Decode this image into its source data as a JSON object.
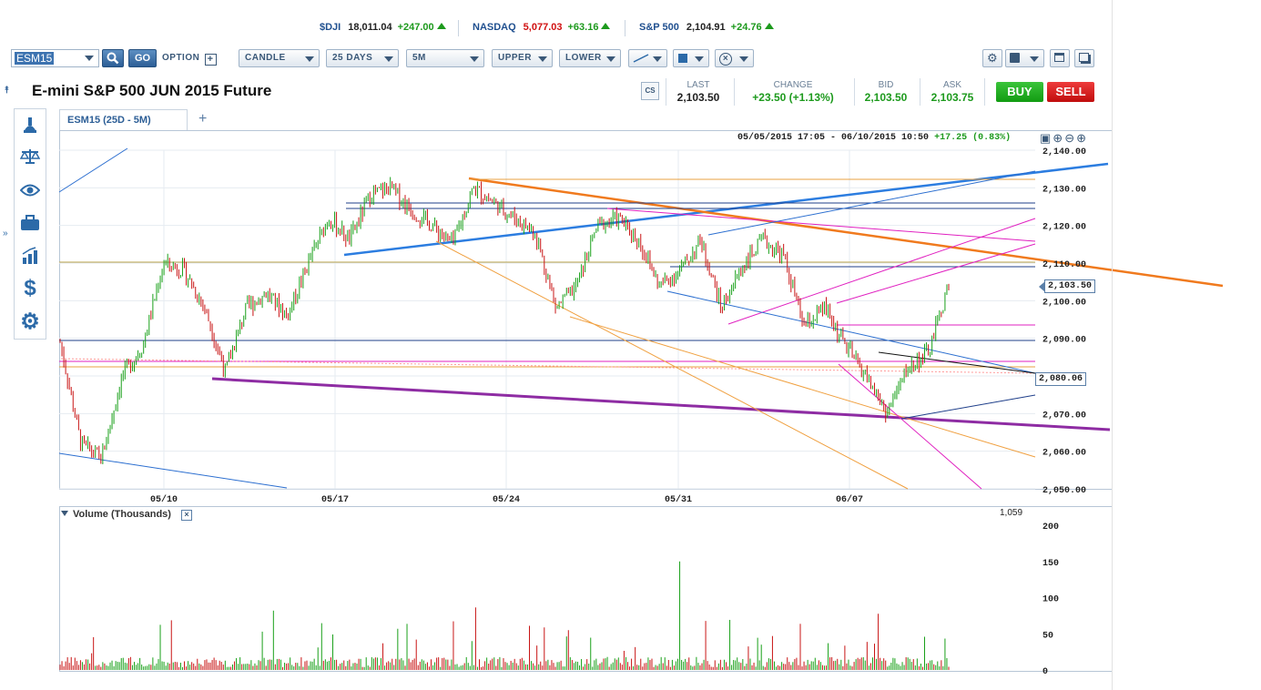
{
  "tickers": [
    {
      "name": "$DJI",
      "value": "18,011.04",
      "change": "+247.00",
      "dir": "up"
    },
    {
      "name": "NASDAQ",
      "value": "5,077.03",
      "change": "+63.16",
      "dir": "up"
    },
    {
      "name": "S&P 500",
      "value": "2,104.91",
      "change": "+24.76",
      "dir": "up"
    }
  ],
  "toolbar": {
    "symbol": "ESM15",
    "go": "GO",
    "option": "OPTION",
    "chart_type": "CANDLE",
    "range": "25 DAYS",
    "interval": "5M",
    "upper": "UPPER",
    "lower": "LOWER"
  },
  "instrument_title": "E-mini S&P 500 JUN 2015 Future",
  "quote": {
    "last_label": "LAST",
    "last": "2,103.50",
    "change_label": "CHANGE",
    "change": "+23.50 (+1.13%)",
    "bid_label": "BID",
    "bid": "2,103.50",
    "ask_label": "ASK",
    "ask": "2,103.75",
    "buy": "BUY",
    "sell": "SELL"
  },
  "chart_tab": "ESM15 (25D - 5M)",
  "date_range": {
    "text": "05/05/2015 17:05 - 06/10/2015 10:50",
    "change": "+17.25 (0.83%)"
  },
  "price_tag": "2,103.50",
  "level_tag": "2,080.06",
  "volume_panel": {
    "title": "Volume (Thousands)",
    "last_value": "1,059"
  },
  "icons": {
    "sidebar": [
      "microscope-icon",
      "scales-icon",
      "eye-icon",
      "briefcase-icon",
      "bar-chart-icon",
      "dollar-icon",
      "gear-icon"
    ]
  },
  "colors": {
    "up": "#1d9a1d",
    "down": "#d01010",
    "candle_up": "#19a019",
    "candle_down": "#c81414"
  },
  "chart_data": {
    "type": "candlestick",
    "x_tick_labels": [
      "05/10",
      "05/17",
      "05/24",
      "05/31",
      "06/07"
    ],
    "y_tick_labels": [
      "2,140.00",
      "2,130.00",
      "2,120.00",
      "2,110.00",
      "2,100.00",
      "2,090.00",
      "2,080.00",
      "2,070.00",
      "2,060.00",
      "2,050.00"
    ],
    "ylim": [
      2050,
      2140
    ],
    "close_path": [
      {
        "d": "05/05",
        "v": 2089
      },
      {
        "d": "05/06",
        "v": 2062
      },
      {
        "d": "05/07",
        "v": 2058
      },
      {
        "d": "05/07b",
        "v": 2080
      },
      {
        "d": "05/08",
        "v": 2088
      },
      {
        "d": "05/08b",
        "v": 2110
      },
      {
        "d": "05/11",
        "v": 2108
      },
      {
        "d": "05/12",
        "v": 2098
      },
      {
        "d": "05/12b",
        "v": 2081
      },
      {
        "d": "05/13",
        "v": 2098
      },
      {
        "d": "05/14",
        "v": 2102
      },
      {
        "d": "05/15",
        "v": 2096
      },
      {
        "d": "05/15b",
        "v": 2110
      },
      {
        "d": "05/18",
        "v": 2122
      },
      {
        "d": "05/19",
        "v": 2116
      },
      {
        "d": "05/20",
        "v": 2128
      },
      {
        "d": "05/21",
        "v": 2130
      },
      {
        "d": "05/21b",
        "v": 2124
      },
      {
        "d": "05/22",
        "v": 2120
      },
      {
        "d": "05/22b",
        "v": 2115
      },
      {
        "d": "05/26",
        "v": 2130
      },
      {
        "d": "05/26b",
        "v": 2126
      },
      {
        "d": "05/27",
        "v": 2122
      },
      {
        "d": "05/27b",
        "v": 2118
      },
      {
        "d": "05/28",
        "v": 2098
      },
      {
        "d": "05/28b",
        "v": 2104
      },
      {
        "d": "05/29",
        "v": 2120
      },
      {
        "d": "05/29b",
        "v": 2122
      },
      {
        "d": "06/01",
        "v": 2116
      },
      {
        "d": "06/01b",
        "v": 2104
      },
      {
        "d": "06/02",
        "v": 2108
      },
      {
        "d": "06/02b",
        "v": 2116
      },
      {
        "d": "06/03",
        "v": 2098
      },
      {
        "d": "06/03b",
        "v": 2109
      },
      {
        "d": "06/04",
        "v": 2116
      },
      {
        "d": "06/04b",
        "v": 2112
      },
      {
        "d": "06/05",
        "v": 2093
      },
      {
        "d": "06/05b",
        "v": 2098
      },
      {
        "d": "06/08",
        "v": 2088
      },
      {
        "d": "06/08b",
        "v": 2080
      },
      {
        "d": "06/09",
        "v": 2070
      },
      {
        "d": "06/09b",
        "v": 2082
      },
      {
        "d": "06/10",
        "v": 2086
      },
      {
        "d": "06/10b",
        "v": 2104
      }
    ],
    "volume_ylim": [
      0,
      200
    ],
    "volume_tick_labels": [
      "200",
      "150",
      "100",
      "50",
      "0"
    ]
  }
}
